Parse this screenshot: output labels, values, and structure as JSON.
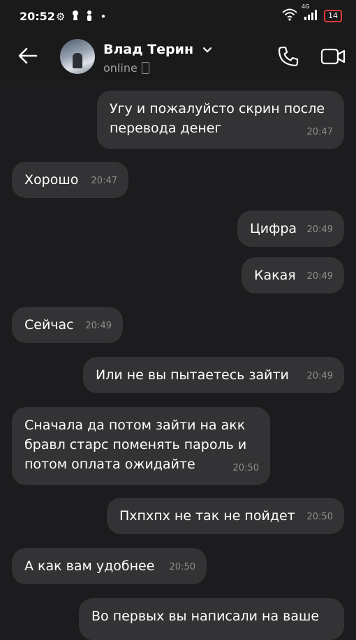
{
  "status_bar": {
    "time": "20:52",
    "network": "4G",
    "battery": "14",
    "battery_level": 0.14
  },
  "header": {
    "contact_name": "Влад Терин",
    "status": "online"
  },
  "messages": [
    {
      "side": "out",
      "text": "Угу и пожалуйсто скрин после перевода денег",
      "time": "20:47"
    },
    {
      "side": "in",
      "text": "Хорошо",
      "time": "20:47"
    },
    {
      "side": "out",
      "text": "Цифра",
      "time": "20:49"
    },
    {
      "side": "out",
      "text": "Какая",
      "time": "20:49"
    },
    {
      "side": "in",
      "text": "Сейчас",
      "time": "20:49"
    },
    {
      "side": "out",
      "text": "Или не вы пытаетесь зайти",
      "time": "20:49"
    },
    {
      "side": "in",
      "text": "Сначала да потом зайти на акк бравл старс поменять пароль и потом оплата ожидайте",
      "time": "20:50"
    },
    {
      "side": "out",
      "text": "Пхпхпх не так не пойдет",
      "time": "20:50"
    },
    {
      "side": "in",
      "text": "А как вам удобнее",
      "time": "20:50"
    },
    {
      "side": "out",
      "text": "Во первых вы написали на ваше",
      "time": ""
    }
  ]
}
